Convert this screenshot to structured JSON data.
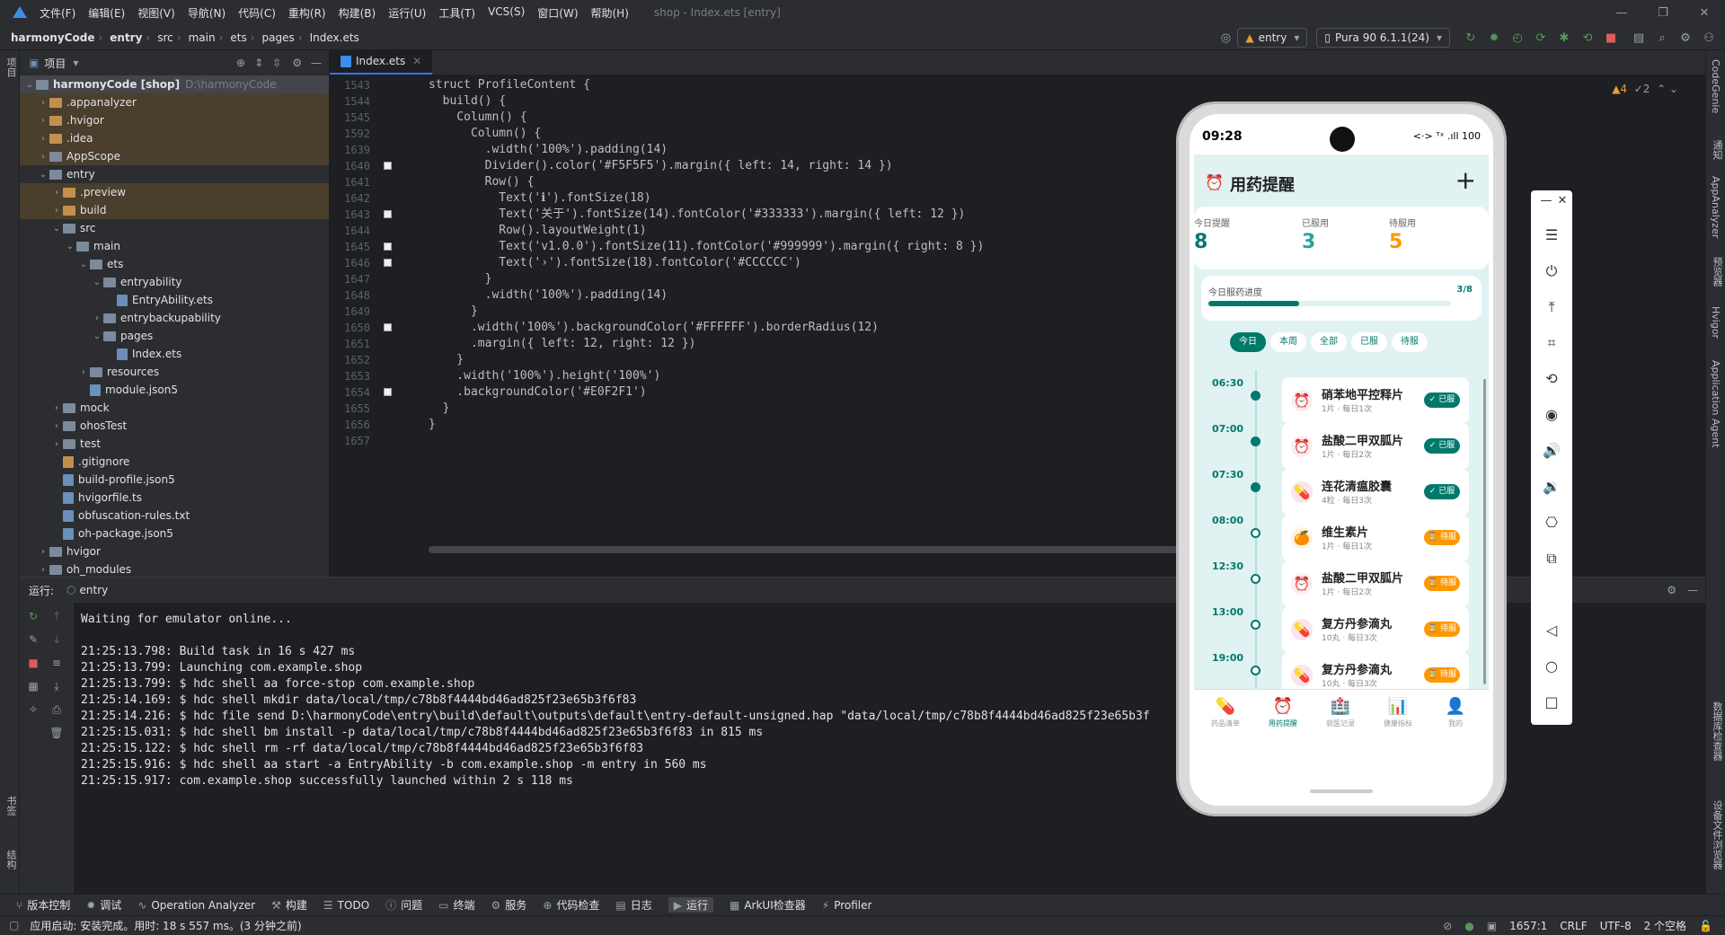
{
  "menu": [
    "文件(F)",
    "编辑(E)",
    "视图(V)",
    "导航(N)",
    "代码(C)",
    "重构(R)",
    "构建(B)",
    "运行(U)",
    "工具(T)",
    "VCS(S)",
    "窗口(W)",
    "帮助(H)"
  ],
  "window_title": "shop - Index.ets [entry]",
  "breadcrumb": [
    "harmonyCode",
    "entry",
    "src",
    "main",
    "ets",
    "pages",
    "Index.ets"
  ],
  "toolbar": {
    "module_combo": "entry",
    "device_combo": "Pura 90 6.1.1(24)"
  },
  "project_panel": {
    "title": "项目",
    "tree": [
      {
        "depth": 0,
        "label": "harmonyCode [shop]",
        "hint": "D:\\harmonyCode",
        "type": "folder",
        "open": true
      },
      {
        "depth": 1,
        "label": ".appanalyzer",
        "type": "folder"
      },
      {
        "depth": 1,
        "label": ".hvigor",
        "type": "folder"
      },
      {
        "depth": 1,
        "label": ".idea",
        "type": "folder"
      },
      {
        "depth": 1,
        "label": "AppScope",
        "type": "folder"
      },
      {
        "depth": 1,
        "label": "entry",
        "type": "folder",
        "open": true
      },
      {
        "depth": 2,
        "label": ".preview",
        "type": "folder"
      },
      {
        "depth": 2,
        "label": "build",
        "type": "folder"
      },
      {
        "depth": 2,
        "label": "src",
        "type": "folder",
        "open": true
      },
      {
        "depth": 3,
        "label": "main",
        "type": "folder",
        "open": true
      },
      {
        "depth": 4,
        "label": "ets",
        "type": "folder",
        "open": true
      },
      {
        "depth": 5,
        "label": "entryability",
        "type": "folder",
        "open": true
      },
      {
        "depth": 6,
        "label": "EntryAbility.ets",
        "type": "file"
      },
      {
        "depth": 5,
        "label": "entrybackupability",
        "type": "folder"
      },
      {
        "depth": 5,
        "label": "pages",
        "type": "folder",
        "open": true
      },
      {
        "depth": 6,
        "label": "Index.ets",
        "type": "file"
      },
      {
        "depth": 4,
        "label": "resources",
        "type": "folder"
      },
      {
        "depth": 4,
        "label": "module.json5",
        "type": "file"
      },
      {
        "depth": 2,
        "label": "mock",
        "type": "folder"
      },
      {
        "depth": 2,
        "label": "ohosTest",
        "type": "folder"
      },
      {
        "depth": 2,
        "label": "test",
        "type": "folder"
      },
      {
        "depth": 2,
        "label": ".gitignore",
        "type": "file"
      },
      {
        "depth": 2,
        "label": "build-profile.json5",
        "type": "file"
      },
      {
        "depth": 2,
        "label": "hvigorfile.ts",
        "type": "file"
      },
      {
        "depth": 2,
        "label": "obfuscation-rules.txt",
        "type": "file"
      },
      {
        "depth": 2,
        "label": "oh-package.json5",
        "type": "file"
      },
      {
        "depth": 1,
        "label": "hvigor",
        "type": "folder"
      },
      {
        "depth": 1,
        "label": "oh_modules",
        "type": "folder"
      }
    ]
  },
  "editor": {
    "tab_label": "Index.ets",
    "warnings": "▲4",
    "weak_warnings": "✓2",
    "lines": [
      {
        "n": "1543",
        "code": "struct ProfileContent {",
        "marker": false
      },
      {
        "n": "1544",
        "code": "  build() {",
        "marker": false
      },
      {
        "n": "1545",
        "code": "    Column() {",
        "marker": false
      },
      {
        "n": "1592",
        "code": "      Column() {",
        "marker": false
      },
      {
        "n": "1639",
        "code": "        .width('100%').padding(14)",
        "marker": false
      },
      {
        "n": "1640",
        "code": "        Divider().color('#F5F5F5').margin({ left: 14, right: 14 })",
        "marker": true
      },
      {
        "n": "1641",
        "code": "        Row() {",
        "marker": false
      },
      {
        "n": "1642",
        "code": "          Text('ℹ').fontSize(18)",
        "marker": false
      },
      {
        "n": "1643",
        "code": "          Text('关于').fontSize(14).fontColor('#333333').margin({ left: 12 })",
        "marker": true
      },
      {
        "n": "1644",
        "code": "          Row().layoutWeight(1)",
        "marker": false
      },
      {
        "n": "1645",
        "code": "          Text('v1.0.0').fontSize(11).fontColor('#999999').margin({ right: 8 })",
        "marker": true
      },
      {
        "n": "1646",
        "code": "          Text('›').fontSize(18).fontColor('#CCCCCC')",
        "marker": true
      },
      {
        "n": "1647",
        "code": "        }",
        "marker": false
      },
      {
        "n": "1648",
        "code": "        .width('100%').padding(14)",
        "marker": false
      },
      {
        "n": "1649",
        "code": "      }",
        "marker": false
      },
      {
        "n": "1650",
        "code": "      .width('100%').backgroundColor('#FFFFFF').borderRadius(12)",
        "marker": true
      },
      {
        "n": "1651",
        "code": "      .margin({ left: 12, right: 12 })",
        "marker": false
      },
      {
        "n": "1652",
        "code": "    }",
        "marker": false
      },
      {
        "n": "1653",
        "code": "    .width('100%').height('100%')",
        "marker": false
      },
      {
        "n": "1654",
        "code": "    .backgroundColor('#E0F2F1')",
        "marker": true
      },
      {
        "n": "1655",
        "code": "  }",
        "marker": false
      },
      {
        "n": "1656",
        "code": "}",
        "marker": false
      },
      {
        "n": "1657",
        "code": "",
        "marker": false
      }
    ]
  },
  "run_panel": {
    "label": "运行:",
    "config": "entry",
    "log": [
      "Waiting for emulator online...",
      "",
      "21:25:13.798: Build task in 16 s 427 ms",
      "21:25:13.799: Launching com.example.shop",
      "21:25:13.799: $ hdc shell aa force-stop com.example.shop",
      "21:25:14.169: $ hdc shell mkdir data/local/tmp/c78b8f4444bd46ad825f23e65b3f6f83",
      "21:25:14.216: $ hdc file send D:\\harmonyCode\\entry\\build\\default\\outputs\\default\\entry-default-unsigned.hap \"data/local/tmp/c78b8f4444bd46ad825f23e65b3f",
      "21:25:15.031: $ hdc shell bm install -p data/local/tmp/c78b8f4444bd46ad825f23e65b3f6f83 in 815 ms",
      "21:25:15.122: $ hdc shell rm -rf data/local/tmp/c78b8f4444bd46ad825f23e65b3f6f83",
      "21:25:15.916: $ hdc shell aa start -a EntryAbility -b com.example.shop -m entry in 560 ms",
      "21:25:15.917: com.example.shop successfully launched within 2 s 118 ms"
    ]
  },
  "bottom_tools": [
    "版本控制",
    "调试",
    "Operation Analyzer",
    "构建",
    "TODO",
    "问题",
    "终端",
    "服务",
    "代码检查",
    "日志",
    "运行",
    "ArkUI检查器",
    "Profiler"
  ],
  "status": {
    "message": "应用启动: 安装完成。用时: 18 s 557 ms。(3 分钟之前)",
    "position": "1657:1",
    "line_sep": "CRLF",
    "encoding": "UTF-8",
    "indent": "2 个空格"
  },
  "right_strip": [
    "CodeGenie",
    "通知",
    "AppAnalyzer",
    "预览器",
    "Hvigor",
    "Application Agent",
    "数据库检查器",
    "设备文件浏览器"
  ],
  "left_strip": [
    "项目",
    "书签",
    "结构"
  ],
  "phone": {
    "time": "09:28",
    "status_icons": "<·> ᵀˣ .ıll 100",
    "app_title": "用药提醒",
    "stats": [
      {
        "label": "今日提醒",
        "value": "8",
        "color": "#00796b"
      },
      {
        "label": "已服用",
        "value": "3",
        "color": "#26a69a"
      },
      {
        "label": "待服用",
        "value": "5",
        "color": "#ff9800"
      }
    ],
    "progress_label": "今日服药进度",
    "progress_text": "3/8",
    "progress_fraction": 0.375,
    "filters": [
      "今日",
      "本周",
      "全部",
      "已服",
      "待服"
    ],
    "active_filter": 0,
    "meds": [
      {
        "time": "06:30",
        "name": "硝苯地平控释片",
        "dose": "1片 · 每日1次",
        "icon": "⏰",
        "status": "已服",
        "taken": true
      },
      {
        "time": "07:00",
        "name": "盐酸二甲双胍片",
        "dose": "1片 · 每日2次",
        "icon": "⏰",
        "status": "已服",
        "taken": true
      },
      {
        "time": "07:30",
        "name": "连花清瘟胶囊",
        "dose": "4粒 · 每日3次",
        "icon": "💊",
        "status": "已服",
        "taken": true
      },
      {
        "time": "08:00",
        "name": "维生素片",
        "dose": "1片 · 每日1次",
        "icon": "🍊",
        "status": "待服",
        "taken": false
      },
      {
        "time": "12:30",
        "name": "盐酸二甲双胍片",
        "dose": "1片 · 每日2次",
        "icon": "⏰",
        "status": "待服",
        "taken": false
      },
      {
        "time": "13:00",
        "name": "复方丹参滴丸",
        "dose": "10丸 · 每日3次",
        "icon": "💊",
        "status": "待服",
        "taken": false
      },
      {
        "time": "19:00",
        "name": "复方丹参滴丸",
        "dose": "10丸 · 每日3次",
        "icon": "💊",
        "status": "待服",
        "taken": false
      }
    ],
    "tabs": [
      {
        "label": "药品清单",
        "icon": "💊",
        "active": false
      },
      {
        "label": "用药提醒",
        "icon": "⏰",
        "active": true
      },
      {
        "label": "就医记录",
        "icon": "🏥",
        "active": false
      },
      {
        "label": "健康指标",
        "icon": "📊",
        "active": false
      },
      {
        "label": "我的",
        "icon": "👤",
        "active": false
      }
    ]
  },
  "emulator_controls": [
    "minimize",
    "close",
    "menu",
    "power",
    "top",
    "crop",
    "rotate",
    "screenshot",
    "vol-up",
    "vol-down",
    "shake",
    "resize",
    "back",
    "home",
    "recent"
  ]
}
